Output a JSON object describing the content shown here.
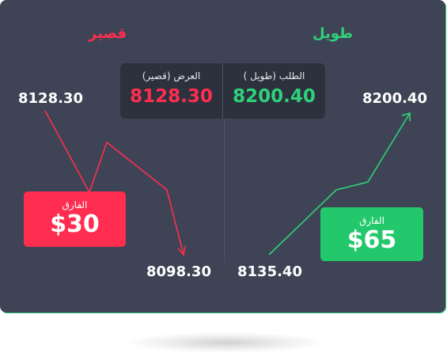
{
  "headings": {
    "short": "قصير",
    "long": "طويل"
  },
  "quote": {
    "bid_label": "العرض (قصير)",
    "bid_value": "8128.30",
    "ask_label": "الطلب (طويل )",
    "ask_value": "8200.40"
  },
  "prices": {
    "short_start": "8128.30",
    "short_end": "8098.30",
    "long_start": "8135.40",
    "long_end": "8200.40"
  },
  "spreads": {
    "short_label": "الفارق",
    "short_value": "$30",
    "long_label": "الفارق",
    "long_value": "$65"
  },
  "colors": {
    "card": "#3e4455",
    "quote_panel": "#2c313d",
    "short": "#ff2d4f",
    "long": "#2fd17a"
  }
}
